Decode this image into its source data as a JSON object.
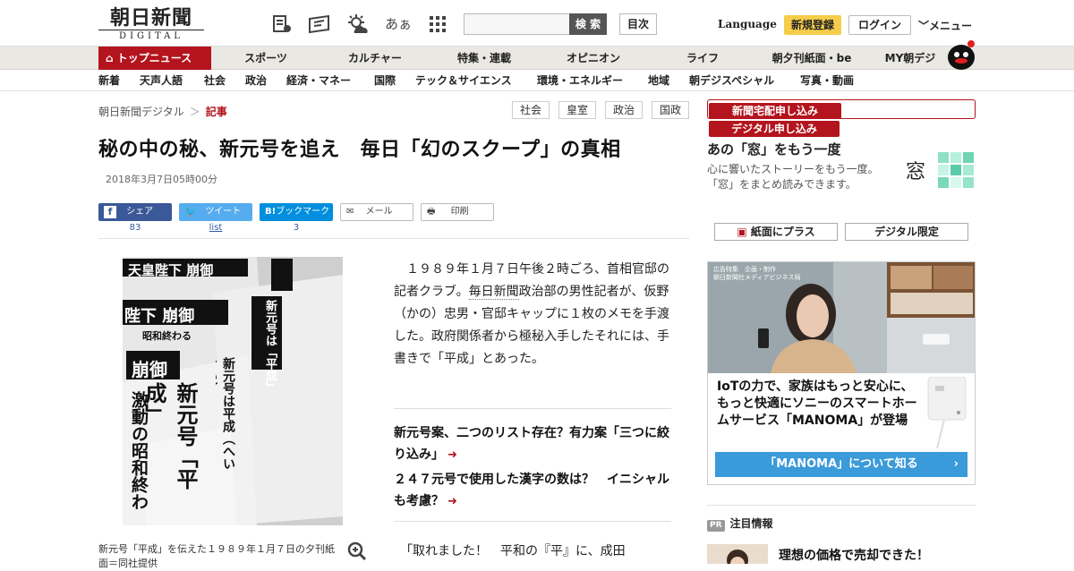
{
  "header": {
    "logo_main": "朝日新聞",
    "logo_sub": "DIGITAL",
    "search_button": "検 索",
    "toc_button": "目次",
    "language": "Language",
    "register": "新規登録",
    "login": "ログイン",
    "menu": "メニュー",
    "fontsize_icon_text": "あぁ"
  },
  "nav_main": {
    "top": "トップニュース",
    "items": [
      "スポーツ",
      "カルチャー",
      "特集・連載",
      "オピニオン",
      "ライフ",
      "朝夕刊紙面・be",
      "MY朝デジ"
    ]
  },
  "nav_sub": {
    "items": [
      "新着",
      "天声人語",
      "社会",
      "政治",
      "経済・マネー",
      "国際",
      "テック＆サイエンス",
      "環境・エネルギー",
      "地域",
      "朝デジスペシャル",
      "写真・動画"
    ]
  },
  "breadcrumb": {
    "home": "朝日新聞デジタル",
    "sep": "＞",
    "current": "記事"
  },
  "tags": [
    "社会",
    "皇室",
    "政治",
    "国政"
  ],
  "subscribe": {
    "paper": "新聞宅配申し込み",
    "digital": "デジタル申し込み"
  },
  "article": {
    "headline": "秘の中の秘、新元号を追え　毎日「幻のスクープ」の真相",
    "date": "2018年3月7日05時00分",
    "photo_caption": "新元号「平成」を伝えた１９８９年１月７日の夕刊紙面＝同社提供",
    "body_p1_a": "　１９８９年１月７日午後２時ごろ、首相官邸の記者クラブ。",
    "body_p1_link": "毎日新聞",
    "body_p1_b": "政治部の男性記者が、仮野（かの）忠男・官邸キャップに１枚のメモを手渡した。政府関係者から極秘入手したそれには、手書きで「平成」とあった。",
    "related": [
      "新元号案、二つのリスト存在？有力案「三つに絞り込み」",
      "２４７元号で使用した漢字の数は？　イニシャルも考慮？"
    ],
    "body_p2": "　「取れました！　平和の『平』に、成田"
  },
  "photo_text": {
    "col1": "天皇陛下 崩御",
    "col2": "陛下 崩御",
    "col3": "昭和終わる",
    "col4": "新元号は「平成」",
    "col5": "崩御",
    "col6": "新元号「平成」",
    "col7": "激動の昭和終わる",
    "col8": "新元号は平成（へいせい）"
  },
  "share": {
    "facebook": "シェア",
    "facebook_count": "83",
    "twitter": "ツイート",
    "twitter_count": "list",
    "hatena": "ブックマーク",
    "hatena_icon": "B!",
    "hatena_count": "3",
    "mail": "メール",
    "print": "印刷"
  },
  "sidebar": {
    "mado_title": "あの「窓」をもう一度",
    "mado_desc": "心に響いたストーリーをもう一度。「窓」をまとめ読みできます。",
    "mado_char": "窓",
    "paper_plus": "紙面にプラス",
    "digital_only": "デジタル限定",
    "ad_label_1": "広告特集　企画・制作",
    "ad_label_2": "朝日新聞社メディアビジネス局",
    "ad_text": "IoTの力で、家族はもっと安心に、もっと快適にソニーのスマートホームサービス「MANOMA」が登場",
    "ad_cta": "「MANOMA」について知る",
    "pr_badge": "PR",
    "pr_title": "注目情報",
    "pr_item": "理想の価格で売却できた！"
  },
  "colors": {
    "accent": "#b4141d",
    "nav_bg": "#eae8e3",
    "facebook": "#3b5998",
    "twitter": "#55acee",
    "hatena": "#008fde",
    "register": "#f6cd4a"
  }
}
